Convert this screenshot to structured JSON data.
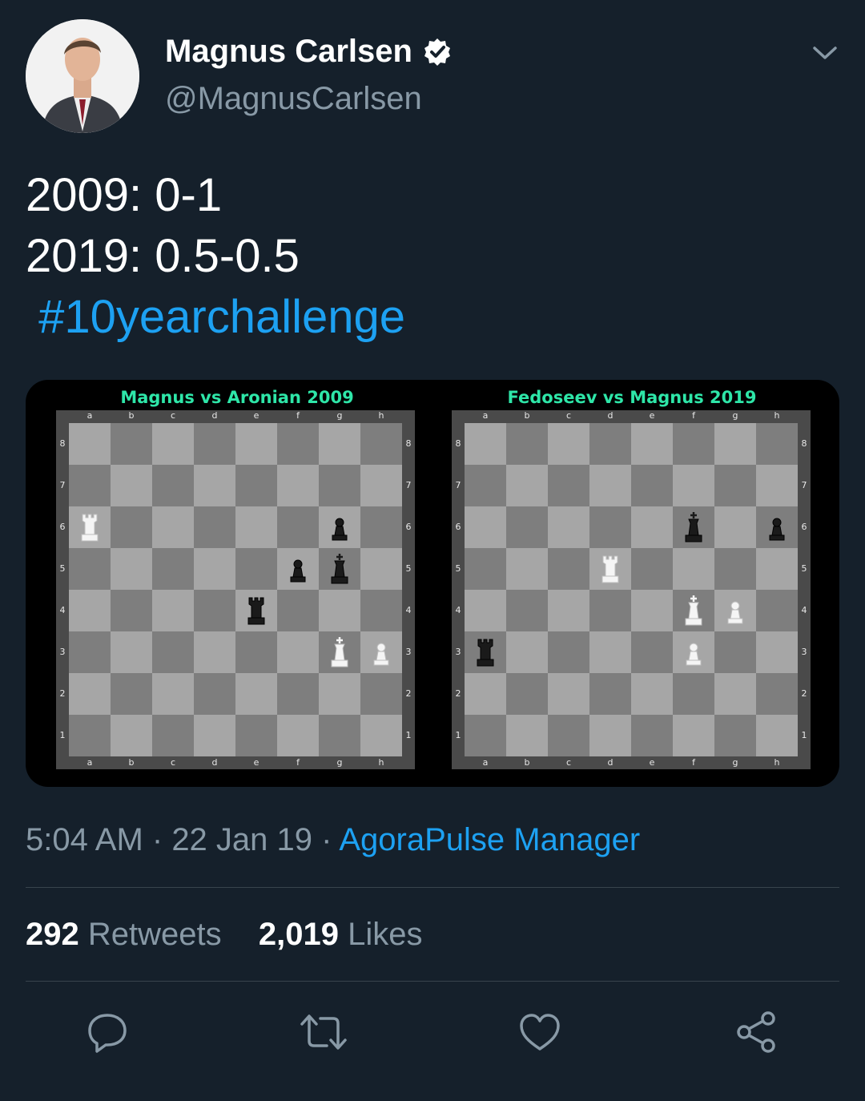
{
  "header": {
    "display_name": "Magnus Carlsen",
    "handle": "@MagnusCarlsen"
  },
  "tweet": {
    "lines": [
      "2009: 0-1",
      "2019: 0.5-0.5"
    ],
    "hashtag": "#10yearchallenge"
  },
  "boards": [
    {
      "title": "Magnus vs Aronian 2009",
      "files": [
        "a",
        "b",
        "c",
        "d",
        "e",
        "f",
        "g",
        "h"
      ],
      "ranks": [
        "8",
        "7",
        "6",
        "5",
        "4",
        "3",
        "2",
        "1"
      ],
      "pieces": [
        {
          "square": "a6",
          "color": "white",
          "type": "rook"
        },
        {
          "square": "g6",
          "color": "black",
          "type": "pawn"
        },
        {
          "square": "f5",
          "color": "black",
          "type": "pawn"
        },
        {
          "square": "g5",
          "color": "black",
          "type": "king"
        },
        {
          "square": "e4",
          "color": "black",
          "type": "rook"
        },
        {
          "square": "g3",
          "color": "white",
          "type": "king"
        },
        {
          "square": "h3",
          "color": "white",
          "type": "pawn"
        }
      ]
    },
    {
      "title": "Fedoseev vs Magnus 2019",
      "files": [
        "a",
        "b",
        "c",
        "d",
        "e",
        "f",
        "g",
        "h"
      ],
      "ranks": [
        "8",
        "7",
        "6",
        "5",
        "4",
        "3",
        "2",
        "1"
      ],
      "pieces": [
        {
          "square": "f6",
          "color": "black",
          "type": "king"
        },
        {
          "square": "h6",
          "color": "black",
          "type": "pawn"
        },
        {
          "square": "d5",
          "color": "white",
          "type": "rook"
        },
        {
          "square": "f4",
          "color": "white",
          "type": "king"
        },
        {
          "square": "g4",
          "color": "white",
          "type": "pawn"
        },
        {
          "square": "a3",
          "color": "black",
          "type": "rook"
        },
        {
          "square": "f3",
          "color": "white",
          "type": "pawn"
        }
      ]
    }
  ],
  "meta": {
    "time": "5:04 AM",
    "sep1": " · ",
    "date": "22 Jan 19",
    "sep2": " · ",
    "source": "AgoraPulse Manager"
  },
  "stats": {
    "retweets_count": "292",
    "retweets_label": "Retweets",
    "likes_count": "2,019",
    "likes_label": "Likes"
  },
  "icons": {
    "reply": "reply-icon",
    "retweet": "retweet-icon",
    "like": "like-icon",
    "share": "share-icon"
  },
  "colors": {
    "background": "#15202b",
    "accent": "#1da1f2",
    "muted": "#8899a6",
    "board_title": "#2ee6a8"
  }
}
